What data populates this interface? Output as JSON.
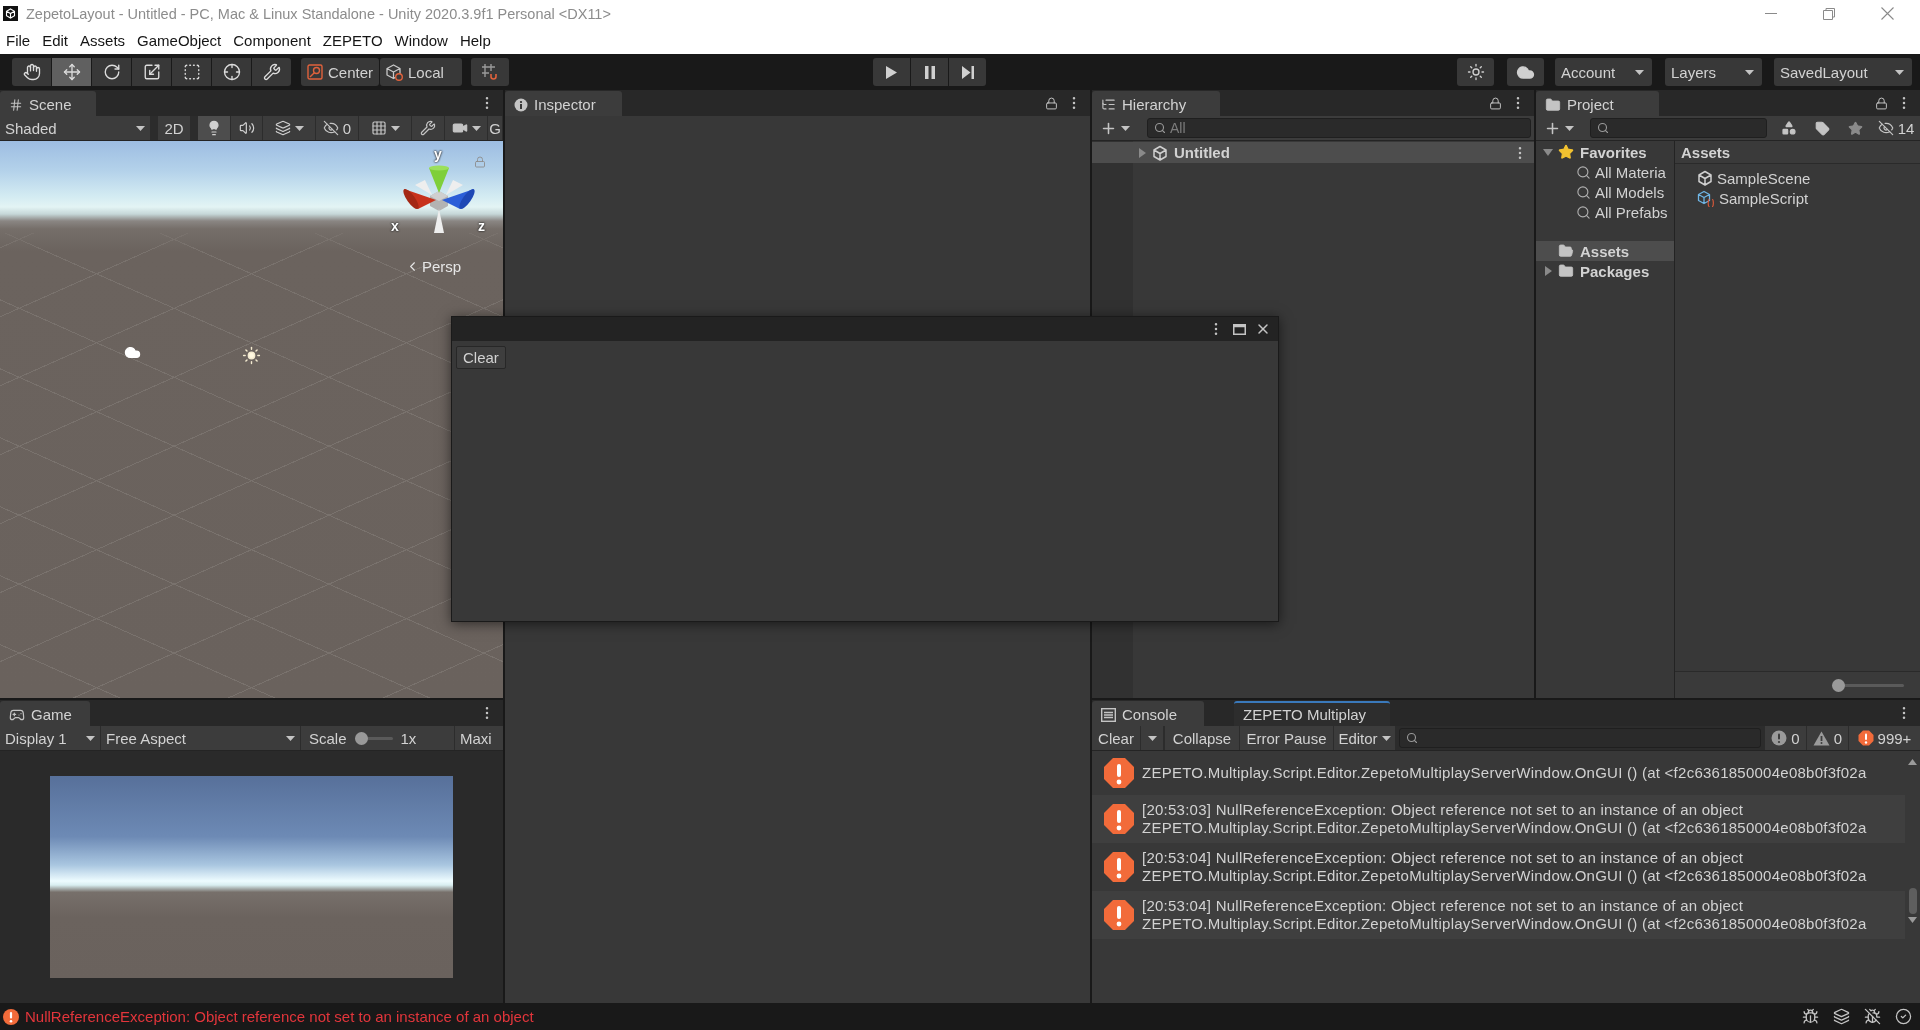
{
  "window": {
    "title": "ZepetoLayout - Untitled - PC, Mac & Linux Standalone - Unity 2020.3.9f1 Personal <DX11>"
  },
  "menu": [
    "File",
    "Edit",
    "Assets",
    "GameObject",
    "Component",
    "ZEPETO",
    "Window",
    "Help"
  ],
  "toolbar": {
    "tools": [
      {
        "kind": "hand",
        "selected": false
      },
      {
        "kind": "move",
        "selected": true
      },
      {
        "kind": "rotate",
        "selected": false
      },
      {
        "kind": "scale",
        "selected": false
      },
      {
        "kind": "rect",
        "selected": false
      },
      {
        "kind": "transform",
        "selected": false
      },
      {
        "kind": "custom",
        "selected": false
      }
    ],
    "handles": [
      {
        "kind": "pivot",
        "label": "Center"
      },
      {
        "kind": "space",
        "label": "Local"
      }
    ],
    "account": "Account",
    "layers": "Layers",
    "layout": "SavedLayout"
  },
  "scene": {
    "tab": "Scene",
    "shading": "Shaded",
    "toggles": [
      {
        "kind": "dimension",
        "label": "2D",
        "on": false
      },
      {
        "kind": "lighting",
        "on": true
      },
      {
        "kind": "audio",
        "on": false
      },
      {
        "kind": "effects",
        "on": false
      }
    ],
    "hidden_count": "0",
    "gizmos": "G",
    "axis_labels": [
      "y",
      "x",
      "z"
    ],
    "projection": "Persp"
  },
  "game": {
    "tab": "Game",
    "display": "Display 1",
    "aspect": "Free Aspect",
    "scale_label": "Scale",
    "scale": {
      "level": 0
    },
    "scale_value": "1x",
    "maximize": "Maxi"
  },
  "inspector": {
    "tab": "Inspector"
  },
  "hierarchy": {
    "tab": "Hierarchy",
    "search": {
      "placeholder": "All"
    },
    "items": [
      {
        "label": "Untitled",
        "selected": true,
        "expanded": false
      }
    ]
  },
  "project": {
    "tab": "Project",
    "hidden_count": "14",
    "tree": [
      {
        "kind": "favorites",
        "label": "Favorites",
        "expanded": true,
        "selected": false,
        "children": [
          {
            "kind": "search",
            "label": "All Materia",
            "selected": false
          },
          {
            "kind": "search",
            "label": "All Models",
            "selected": false
          },
          {
            "kind": "search",
            "label": "All Prefabs",
            "selected": false
          }
        ]
      },
      {
        "kind": "folder",
        "label": "Assets",
        "selected": true
      },
      {
        "kind": "folder",
        "label": "Packages",
        "expanded": false,
        "selected": false
      }
    ],
    "path": "Assets",
    "assets": [
      {
        "kind": "scene",
        "label": "SampleScene"
      },
      {
        "kind": "script",
        "label": "SampleScript"
      }
    ],
    "icon_size": {
      "level": 0
    }
  },
  "console": {
    "tabs": [
      {
        "label": "Console",
        "selected": true,
        "focused": false
      },
      {
        "label": "ZEPETO Multiplay",
        "selected": false,
        "focused": true
      }
    ],
    "clear": "Clear",
    "toggles": [
      "Collapse",
      "Error Pause"
    ],
    "target": "Editor",
    "counts": [
      {
        "kind": "info",
        "count": "0"
      },
      {
        "kind": "warning",
        "count": "0"
      },
      {
        "kind": "error",
        "count": "999+"
      }
    ],
    "entries": [
      {
        "kind": "error",
        "trace": "ZEPETO.Multiplay.Script.Editor.ZepetoMultiplayServerWindow.OnGUI () (at <f2c6361850004e08b0f3f02a"
      },
      {
        "kind": "error",
        "message": "[20:53:03] NullReferenceException: Object reference not set to an instance of an object",
        "trace": "ZEPETO.Multiplay.Script.Editor.ZepetoMultiplayServerWindow.OnGUI () (at <f2c6361850004e08b0f3f02a"
      },
      {
        "kind": "error",
        "message": "[20:53:04] NullReferenceException: Object reference not set to an instance of an object",
        "trace": "ZEPETO.Multiplay.Script.Editor.ZepetoMultiplayServerWindow.OnGUI () (at <f2c6361850004e08b0f3f02a"
      },
      {
        "kind": "error",
        "message": "[20:53:04] NullReferenceException: Object reference not set to an instance of an object",
        "trace": "ZEPETO.Multiplay.Script.Editor.ZepetoMultiplayServerWindow.OnGUI () (at <f2c6361850004e08b0f3f02a"
      }
    ]
  },
  "floating_window": {
    "clear": "Clear"
  },
  "status_bar": {
    "message": "NullReferenceException: Object reference not set to an instance of an object"
  }
}
